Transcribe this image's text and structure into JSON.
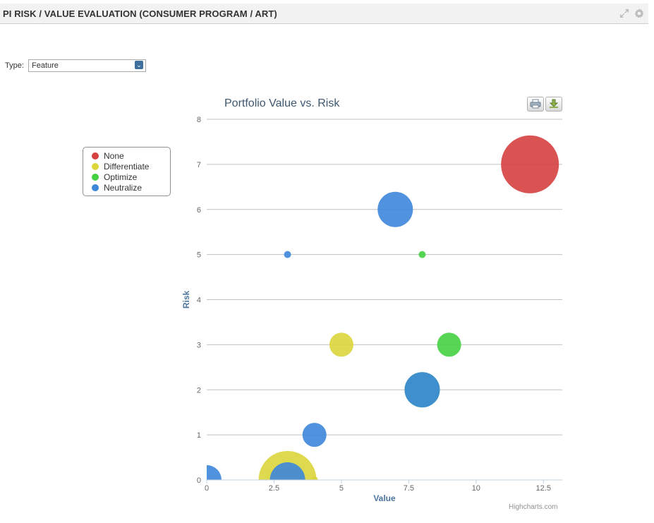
{
  "panel": {
    "title": "PI RISK / VALUE EVALUATION (CONSUMER PROGRAM / ART)",
    "icons": [
      "expand-icon",
      "gear-icon"
    ]
  },
  "filter": {
    "type_label": "Type:",
    "type_value": "Feature"
  },
  "credits": "Highcharts.com",
  "chart_data": {
    "type": "scatter",
    "subtype": "bubble",
    "title": "Portfolio Value vs. Risk",
    "xlabel": "Value",
    "ylabel": "Risk",
    "xlim": [
      0,
      13.2
    ],
    "ylim": [
      0,
      8
    ],
    "xticks": [
      0,
      2.5,
      5,
      7.5,
      10,
      12.5
    ],
    "xtick_labels": [
      "0",
      "2.5",
      "5",
      "7.5",
      "10",
      "12.5"
    ],
    "yticks": [
      0,
      1,
      2,
      3,
      4,
      5,
      6,
      7,
      8
    ],
    "ytick_labels": [
      "0",
      "1",
      "2",
      "3",
      "4",
      "5",
      "6",
      "7",
      "8"
    ],
    "grid": "horizontal",
    "legend_position": "left",
    "series": [
      {
        "name": "None",
        "color": "#d64040",
        "points": [
          {
            "x": 12,
            "y": 7,
            "size": 10
          }
        ]
      },
      {
        "name": "Differentiate",
        "color": "#dcd53c",
        "points": [
          {
            "x": 3,
            "y": 0,
            "size": 10
          },
          {
            "x": 5,
            "y": 3,
            "size": 4
          },
          {
            "x": 4,
            "y": 0,
            "size": 1
          }
        ]
      },
      {
        "name": "Optimize",
        "color": "#45d143",
        "points": [
          {
            "x": 9,
            "y": 3,
            "size": 4
          },
          {
            "x": 8,
            "y": 5,
            "size": 1
          },
          {
            "x": 8,
            "y": 2,
            "size": 6
          }
        ]
      },
      {
        "name": "Neutralize",
        "color": "#3d86da",
        "points": [
          {
            "x": 7,
            "y": 6,
            "size": 6
          },
          {
            "x": 3,
            "y": 5,
            "size": 1
          },
          {
            "x": 4,
            "y": 1,
            "size": 4
          },
          {
            "x": 0,
            "y": 0,
            "size": 5
          },
          {
            "x": 3,
            "y": 0,
            "size": 6
          },
          {
            "x": 8,
            "y": 2,
            "size": 6
          }
        ]
      }
    ]
  }
}
